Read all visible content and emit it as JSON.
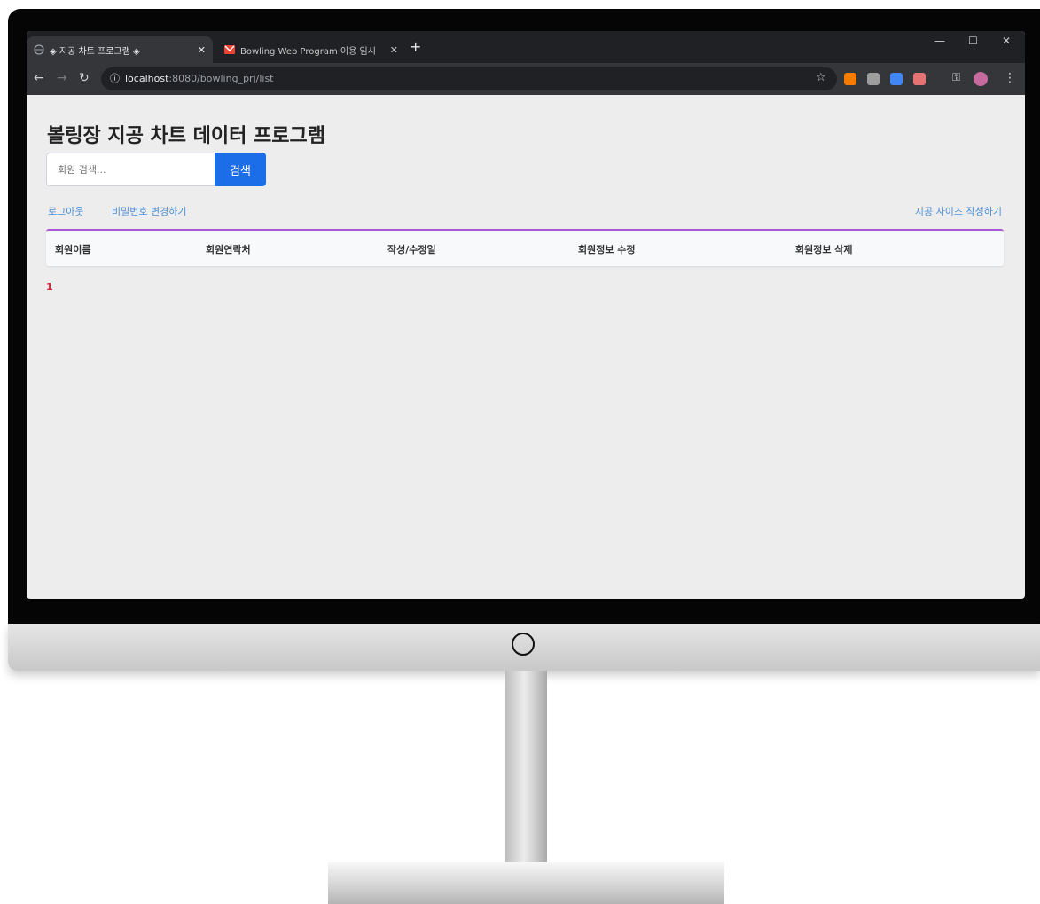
{
  "browser": {
    "tabs": [
      {
        "title": "◈ 지공 차트 프로그램 ◈",
        "active": true
      },
      {
        "title": "Bowling Web Program 이용 임시",
        "active": false
      }
    ],
    "url_host": "localhost",
    "url_path": ":8080/bowling_prj/list"
  },
  "page": {
    "title": "볼링장 지공 차트 데이터 프로그램",
    "search": {
      "placeholder": "회원 검색...",
      "button_label": "검색"
    },
    "links": {
      "logout": "로그아웃",
      "change_password": "비밀번호 변경하기",
      "write_size": "지공 사이즈 작성하기"
    },
    "table": {
      "headers": [
        "회원이름",
        "회원연락처",
        "작성/수정일",
        "회원정보 수정",
        "회원정보 삭제"
      ],
      "rows": []
    },
    "pagination": {
      "current": "1"
    }
  },
  "colors": {
    "primary": "#1b6ee8",
    "table_accent": "#a855d8",
    "link": "#4a8fd8",
    "page_number": "#e0213a"
  }
}
